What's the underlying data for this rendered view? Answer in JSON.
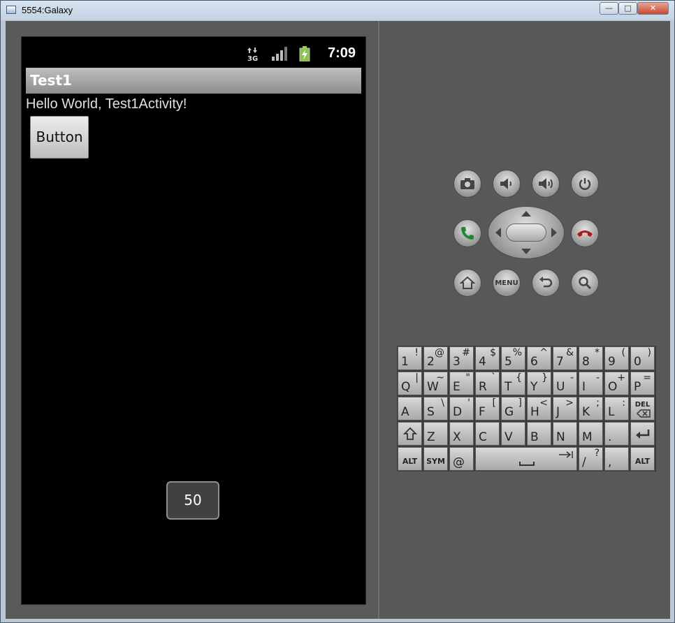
{
  "window": {
    "title": "5554:Galaxy",
    "min": "—",
    "max": "□",
    "close": "✕"
  },
  "status": {
    "time": "7:09",
    "network": "3G"
  },
  "app": {
    "title": "Test1",
    "hello": "Hello World, Test1Activity!",
    "button": "Button",
    "toast": "50"
  },
  "controls": {
    "menu_label": "MENU"
  },
  "keyboard": {
    "row1": [
      [
        "1",
        "!"
      ],
      [
        "2",
        "@"
      ],
      [
        "3",
        "#"
      ],
      [
        "4",
        "$"
      ],
      [
        "5",
        "%"
      ],
      [
        "6",
        "^"
      ],
      [
        "7",
        "&"
      ],
      [
        "8",
        "*"
      ],
      [
        "9",
        "("
      ],
      [
        "0",
        ")"
      ]
    ],
    "row2": [
      [
        "Q",
        "|"
      ],
      [
        "W",
        "~"
      ],
      [
        "E",
        "\""
      ],
      [
        "R",
        "`"
      ],
      [
        "T",
        "{"
      ],
      [
        "Y",
        "}"
      ],
      [
        "U",
        "-"
      ],
      [
        "I",
        "-"
      ],
      [
        "O",
        "+"
      ],
      [
        "P",
        "="
      ]
    ],
    "row3": [
      [
        "A",
        ""
      ],
      [
        "S",
        "\\"
      ],
      [
        "D",
        "'"
      ],
      [
        "F",
        "["
      ],
      [
        "G",
        "]"
      ],
      [
        "H",
        "<"
      ],
      [
        "J",
        ">"
      ],
      [
        "K",
        ";"
      ],
      [
        "L",
        ":"
      ]
    ],
    "row4": [
      [
        "Z",
        ""
      ],
      [
        "X",
        ""
      ],
      [
        "C",
        ""
      ],
      [
        "V",
        ""
      ],
      [
        "B",
        ""
      ],
      [
        "N",
        ""
      ],
      [
        "M",
        ""
      ],
      [
        ".",
        ""
      ]
    ],
    "del": "DEL",
    "alt": "ALT",
    "sym": "SYM",
    "at": "@",
    "slash": "/",
    "question": "?",
    "comma": ","
  }
}
